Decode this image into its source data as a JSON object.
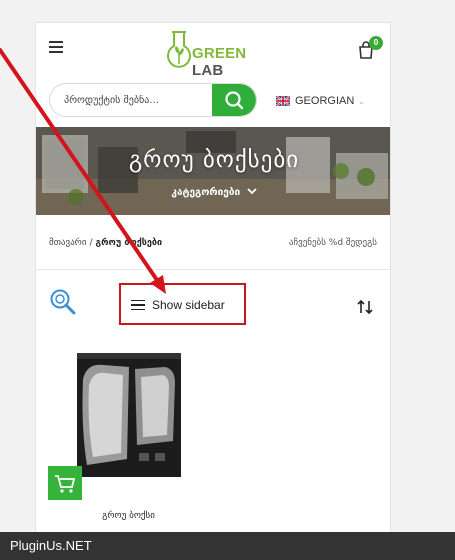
{
  "header": {
    "logo_text_green": "GREEN",
    "logo_text_dark": "LAB",
    "cart_count": "0"
  },
  "search": {
    "placeholder": "პროდუქტის მებნა..."
  },
  "language": {
    "label": "GEORGIAN"
  },
  "banner": {
    "title": "გროუ ბოქსები",
    "subtitle": "კატეგორიები"
  },
  "breadcrumb": {
    "home": "მთავარი",
    "separator": "/",
    "current": "გროუ ბოქსები"
  },
  "results": {
    "showing": "აჩვენებს %d შედეგს"
  },
  "toolbar": {
    "show_sidebar": "Show sidebar"
  },
  "products": [
    {
      "title": "გროუ ბოქსი"
    }
  ],
  "footer": {
    "watermark": "PluginUs.NET"
  },
  "colors": {
    "accent_green": "#2fae3a",
    "annotation_red": "#c8161d"
  }
}
